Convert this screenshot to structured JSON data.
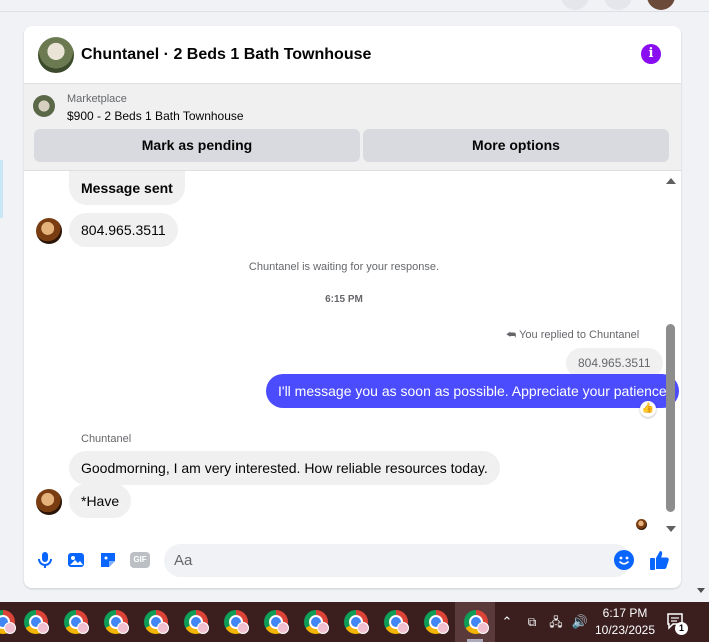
{
  "chat": {
    "title": "Chuntanel · 2 Beds 1 Bath Townhouse",
    "info_icon": "info-icon",
    "marketplace": {
      "label": "Marketplace",
      "listing": "$900 - 2 Beds 1 Bath Townhouse",
      "mark_pending_label": "Mark as pending",
      "more_options_label": "More options"
    }
  },
  "messages": {
    "message_sent": "Message sent",
    "phone_incoming": "804.965.3511",
    "waiting_status": "Chuntanel is waiting for your response.",
    "timestamp": "6:15 PM",
    "reply_indicator": "You replied to Chuntanel",
    "quoted_reply": "804.965.3511",
    "outgoing": "I'll message you as soon as possible. Appreciate your patience",
    "sender_name": "Chuntanel",
    "incoming_1": "Goodmorning, I am very interested. How reliable resources today.",
    "incoming_2": "*Have"
  },
  "composer": {
    "placeholder": "Aa",
    "gif_label": "GIF"
  },
  "taskbar": {
    "time": "6:17 PM",
    "date": "10/23/2025",
    "notification_count": "1"
  },
  "colors": {
    "accent": "#0866ff",
    "outgoing_bubble": "#4c4cff",
    "info_purple": "#8a0cf0",
    "taskbar": "#3b1f1f"
  }
}
